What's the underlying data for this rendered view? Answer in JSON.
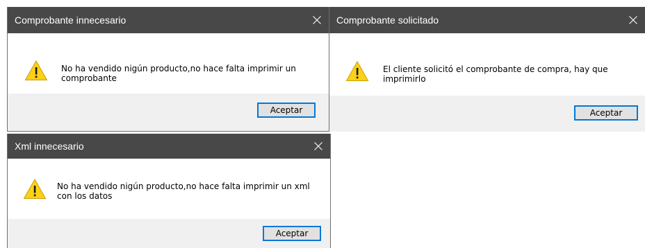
{
  "dialogs": [
    {
      "title": "Comprobante innecesario",
      "message": "No ha vendido nigún producto,no hace falta imprimir un comprobante",
      "button_label": "Aceptar",
      "icon": "warning-icon"
    },
    {
      "title": "Comprobante solicitado",
      "message": "El cliente solicitó el comprobante de compra, hay que imprimirlo",
      "button_label": "Aceptar",
      "icon": "warning-icon"
    },
    {
      "title": "Xml innecesario",
      "message": "No ha vendido nigún producto,no hace falta imprimir un xml con los datos",
      "button_label": "Aceptar",
      "icon": "warning-icon"
    }
  ],
  "colors": {
    "titlebar": "#484848",
    "footer": "#f0f0f0",
    "button_border": "#0078d7",
    "button_fill": "#e1e1e1",
    "warning_yellow": "#fcd116"
  }
}
